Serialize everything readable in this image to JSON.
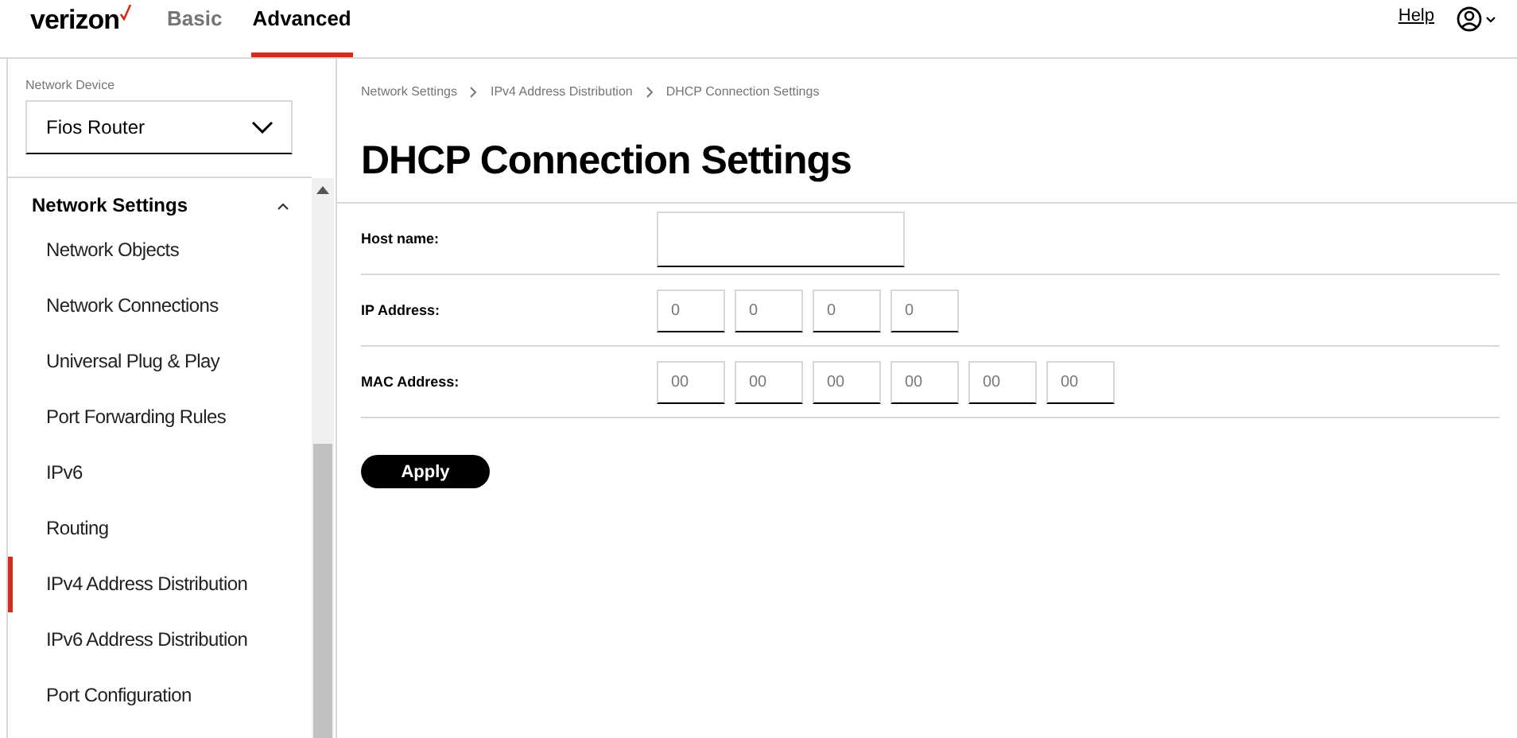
{
  "header": {
    "logo": "verizon",
    "tabs": [
      {
        "label": "Basic",
        "selected": false
      },
      {
        "label": "Advanced",
        "selected": true
      }
    ],
    "help": "Help"
  },
  "sidebar": {
    "device_label": "Network Device",
    "device": "Fios Router",
    "section": {
      "title": "Network Settings",
      "expanded": true,
      "items": [
        {
          "label": "Network Objects",
          "selected": false
        },
        {
          "label": "Network Connections",
          "selected": false
        },
        {
          "label": "Universal Plug & Play",
          "selected": false
        },
        {
          "label": "Port Forwarding Rules",
          "selected": false
        },
        {
          "label": "IPv6",
          "selected": false
        },
        {
          "label": "Routing",
          "selected": false
        },
        {
          "label": "IPv4 Address Distribution",
          "selected": true
        },
        {
          "label": "IPv6 Address Distribution",
          "selected": false
        },
        {
          "label": "Port Configuration",
          "selected": false
        }
      ]
    }
  },
  "breadcrumb": [
    "Network Settings",
    "IPv4 Address Distribution",
    "DHCP Connection Settings"
  ],
  "title": "DHCP Connection Settings",
  "form": [
    {
      "label": "Host name:",
      "kind": "text"
    },
    {
      "label": "IP Address:",
      "kind": "octets",
      "placeholders": [
        "0",
        "0",
        "0",
        "0"
      ]
    },
    {
      "label": "MAC Address:",
      "kind": "octets",
      "placeholders": [
        "00",
        "00",
        "00",
        "00",
        "00",
        "00"
      ]
    }
  ],
  "apply": "Apply"
}
